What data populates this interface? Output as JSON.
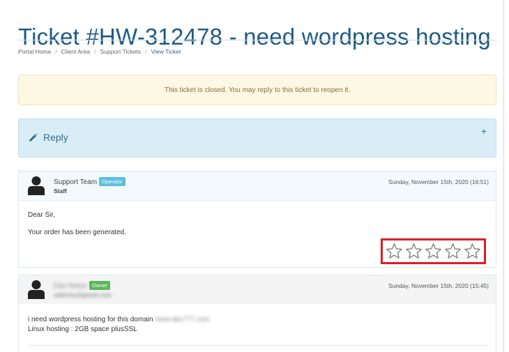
{
  "page": {
    "title": "Ticket #HW-312478 - need wordpress hosting"
  },
  "breadcrumb": {
    "items": [
      "Portal Home",
      "Client Area",
      "Support Tickets",
      "View Ticket"
    ],
    "separator": "/"
  },
  "alert": {
    "text": "This ticket is closed. You may reply to this ticket to reopen it."
  },
  "reply_panel": {
    "label": "Reply",
    "toggle": "+"
  },
  "messages": [
    {
      "sender": "Support Team",
      "badge": "Operator",
      "role": "Staff",
      "date": "Sunday, November 15th, 2020 (16:51)",
      "lines": [
        "Dear Sir,",
        "Your order has been generated."
      ],
      "rating": {
        "max": 5,
        "value": 0
      }
    },
    {
      "sender": "Dan Name",
      "badge": "Owner",
      "role": "address@gmail.com",
      "date": "Sunday, November 15th, 2020 (15:45)",
      "lines": [
        "i need wordpress hosting for this domain",
        "Linux hosting : 2GB space plusSSL"
      ],
      "redacted_domain": "www.abc777.com"
    }
  ],
  "colors": {
    "title": "#1c5a85",
    "alert_bg": "#fcf8e3",
    "reply_bg": "#d9edf7",
    "operator_badge": "#5bc0de",
    "owner_badge": "#5cb85c",
    "highlight": "#e31b23"
  }
}
